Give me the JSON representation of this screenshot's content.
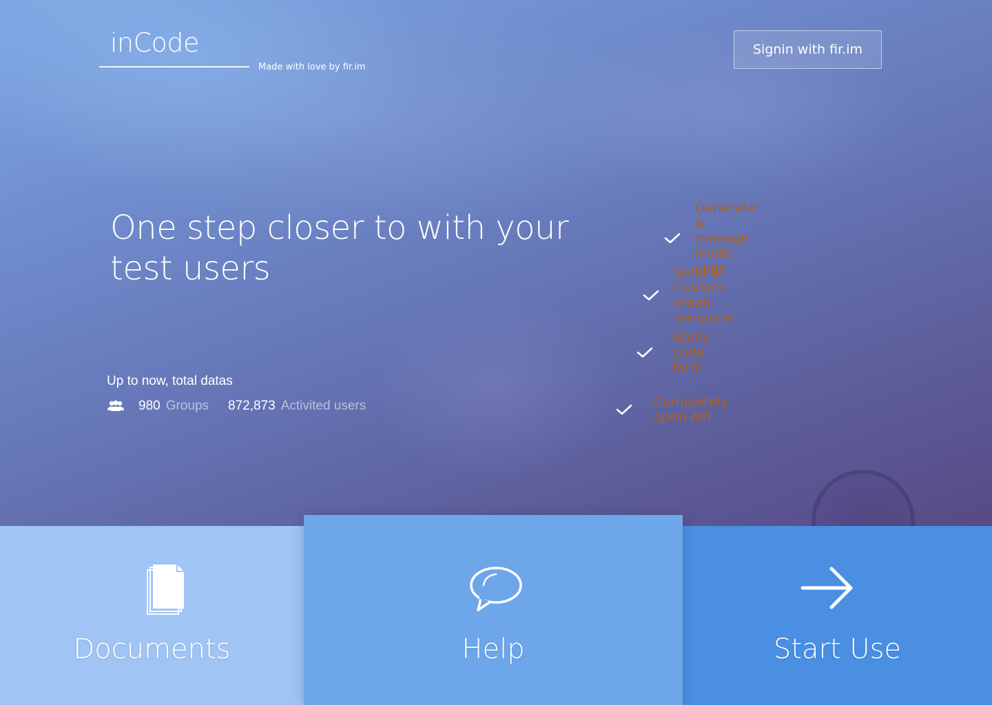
{
  "header": {
    "logo": "inCode",
    "tagline": "Made with love by fir.im",
    "signin_label": "Signin with fir.im"
  },
  "hero": {
    "headline_line1": "One step closer to with your",
    "headline_line2": "test users"
  },
  "stats": {
    "title": "Up to now, total datas",
    "groups_count": "980",
    "groups_label": "Groups",
    "users_count": "872,873",
    "users_label": "Activited users"
  },
  "features": [
    {
      "label": "Generate & manage invite code"
    },
    {
      "label": "Send & Custom email template"
    },
    {
      "label": "Apply code form"
    },
    {
      "label": "Completely open API"
    }
  ],
  "tiles": {
    "documents": {
      "label": "Documents",
      "icon": "documents-icon"
    },
    "help": {
      "label": "Help",
      "icon": "speech-bubble-icon"
    },
    "start": {
      "label": "Start Use",
      "icon": "arrow-right-icon"
    }
  },
  "colors": {
    "feature_bg": "#ffbb80",
    "feature_text": "#b0601c",
    "tile_documents": "#a0c4f4",
    "tile_help": "#6ea6ea",
    "tile_start": "#4a8fe2"
  }
}
